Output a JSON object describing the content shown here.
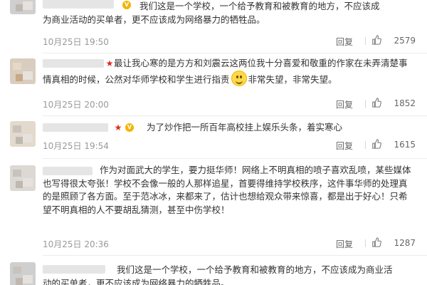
{
  "comments": [
    {
      "text_line1": "我们这是一个学校，一个给予教育和被教育的地方，不应该成",
      "text_rest": "为商业活动的买单者，更不应该成为网络暴力的牺牲品。",
      "time": "10月25日 19:50",
      "reply_label": "回复",
      "likes": "2579"
    },
    {
      "text_part1": "最让我心寒的是方方和刘震云这两位我十分喜爱和敬重的作家在未弄清楚事情真相的时候，公然对华师学校和学生进行指责",
      "text_part2": "非常失望，非常失望。",
      "time": "10月25日 20:00",
      "reply_label": "回复",
      "likes": "1852"
    },
    {
      "text": "为了炒作把一所百年高校挂上娱乐头条，着实寒心",
      "time": "10月25日 19:54",
      "reply_label": "回复",
      "likes": "1615"
    },
    {
      "text": "作为对面武大的学生，要力挺华师！网络上不明真相的喷子喜欢乱喷，某些媒体也写得很太夸张！学校不会像一般的人那样追星，首要得维持学校秩序，这件事华师的处理真的是照顾了各方面。至于范冰冰，来都来了，估计也想给观众带来惊喜，都是出于好心！只希望不明真相的人不要胡乱猜测，甚至中伤学校！",
      "time": "10月25日 20:36",
      "reply_label": "回复",
      "likes": "1287"
    },
    {
      "text_line1": "我们这是一个学校，一个给予教育和被教育的地方，不应该成为商业活",
      "text_line2": "动的买单者，更不应该成为网络暴力的牺牲品。"
    }
  ],
  "colors": {
    "text": "#333333",
    "meta": "#999999",
    "star": "#e0281f",
    "vip": "#f4b400"
  },
  "icons": {
    "like": "thumbs-up-icon",
    "emoji": "smiley-emoji-icon",
    "star": "star-badge-icon",
    "vip": "vip-badge-icon"
  }
}
